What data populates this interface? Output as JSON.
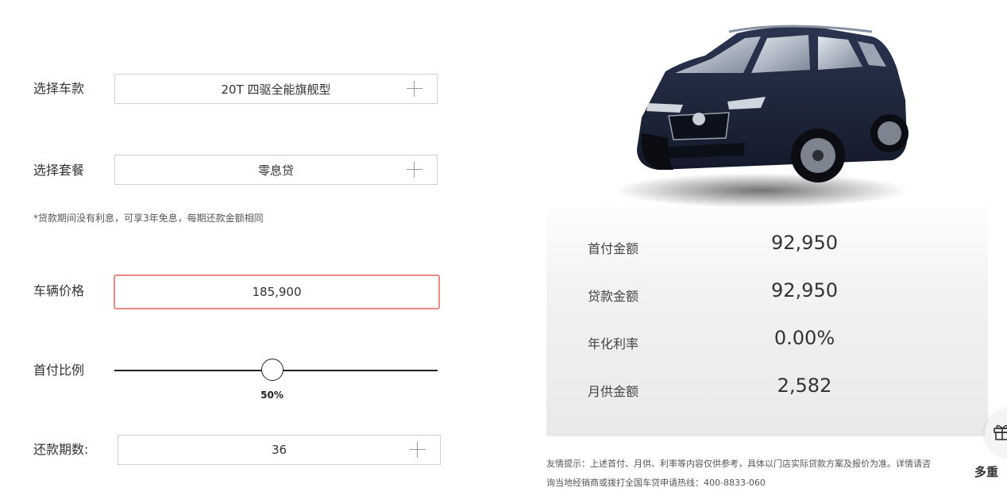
{
  "form": {
    "model": {
      "label": "选择车款",
      "value": "20T 四驱全能旗舰型"
    },
    "plan": {
      "label": "选择套餐",
      "value": "零息贷"
    },
    "plan_note": "*贷款期间没有利息，可享3年免息，每期还款金额相同",
    "price": {
      "label": "车辆价格",
      "value": "185,900"
    },
    "down_ratio": {
      "label": "首付比例",
      "value_text": "50%",
      "value": 0.5
    },
    "term": {
      "label": "还款期数:",
      "value": "36"
    }
  },
  "results": {
    "down_payment": {
      "label": "首付金额",
      "value": "92,950"
    },
    "loan_amount": {
      "label": "贷款金额",
      "value": "92,950"
    },
    "annual_rate": {
      "label": "年化利率",
      "value": "0.00%"
    },
    "monthly": {
      "label": "月供金额",
      "value": "2,582"
    }
  },
  "disclaimer": {
    "line1": "友情提示：上述首付、月供、利率等内容仅供参考，具体以门店实际贷款方案及报价为准。详情请咨",
    "line2": "询当地经销商或拨打全国车贷申请热线：400-8833-060"
  },
  "side": {
    "text": "多重"
  },
  "colors": {
    "accent_border": "#e8898a",
    "car_body": "#1c2438"
  },
  "icons": {
    "plus": "plus-icon",
    "gift": "gift-icon"
  }
}
